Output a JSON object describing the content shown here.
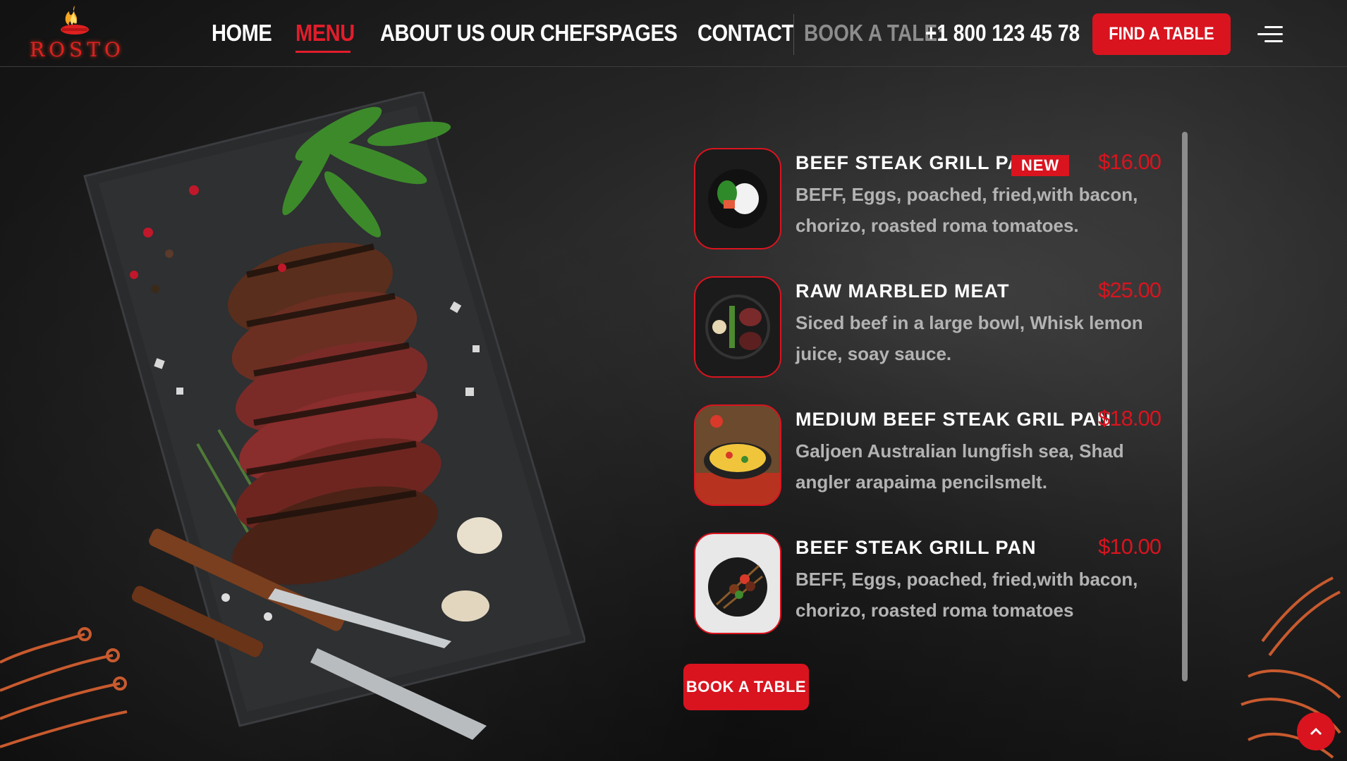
{
  "brand": {
    "name": "ROSTO"
  },
  "nav": {
    "items": [
      {
        "label": "HOME"
      },
      {
        "label": "MENU"
      },
      {
        "label": "ABOUT US"
      },
      {
        "label": "OUR CHEFS"
      },
      {
        "label": "PAGES"
      },
      {
        "label": "CONTACT"
      }
    ],
    "active": "MENU",
    "book_label": "BOOK A TALE:",
    "phone": "+1 800 123 45 78",
    "cta": "FIND A TABLE"
  },
  "menu": {
    "items": [
      {
        "title": "BEEF STEAK GRILL PAN",
        "badge": "NEW",
        "price": "$16.00",
        "desc": "BEFF, Eggs, poached, fried,with bacon, chorizo, roasted roma tomatoes."
      },
      {
        "title": "RAW MARBLED MEAT",
        "badge": "",
        "price": "$25.00",
        "desc": "Siced beef in a large bowl, Whisk lemon juice, soay sauce."
      },
      {
        "title": "MEDIUM BEEF STEAK GRIL PAN",
        "badge": "",
        "price": "$18.00",
        "desc": "Galjoen Australian lungfish sea, Shad angler arapaima pencilsmelt."
      },
      {
        "title": "BEEF STEAK GRILL PAN",
        "badge": "",
        "price": "$10.00",
        "desc": "BEFF, Eggs, poached, fried,with bacon, chorizo, roasted roma tomatoes"
      }
    ],
    "book_button": "BOOK A TABLE"
  },
  "colors": {
    "accent": "#d9141f",
    "background": "#1c1c1c",
    "muted_text": "#b3b3b3"
  },
  "icons": {
    "menu": "hamburger-icon",
    "back_to_top": "chevron-up-icon",
    "logo": "flame-icon"
  }
}
